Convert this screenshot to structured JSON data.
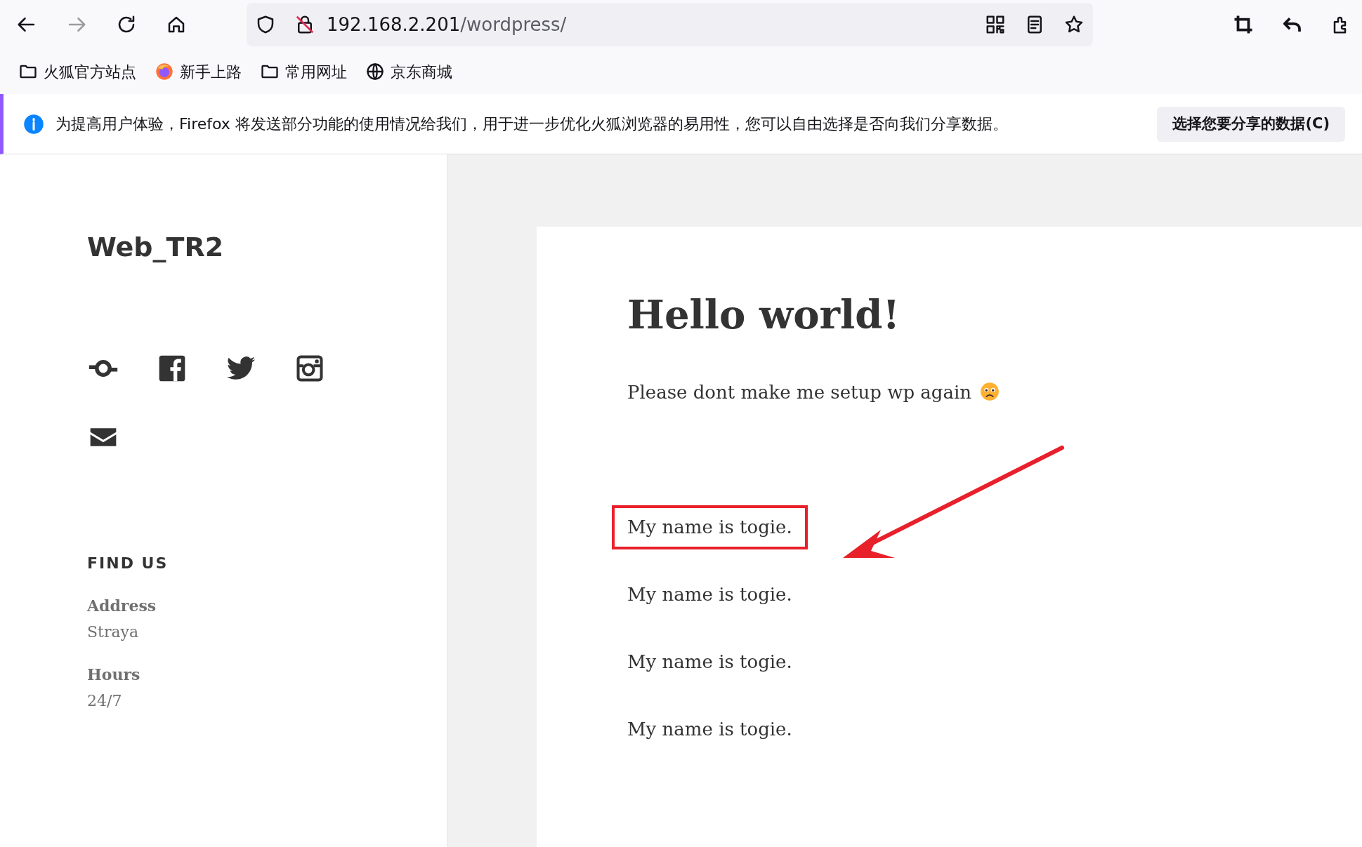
{
  "toolbar": {
    "nav_buttons": [
      {
        "kind": "back",
        "disabled": false
      },
      {
        "kind": "forward",
        "disabled": true
      },
      {
        "kind": "reload",
        "disabled": false
      },
      {
        "kind": "home",
        "disabled": false
      }
    ],
    "url": {
      "host": "192.168.2.201",
      "path": "/wordpress/"
    }
  },
  "bookmarks": [
    {
      "kind": "folder",
      "label": "火狐官方站点"
    },
    {
      "kind": "firefox",
      "label": "新手上路"
    },
    {
      "kind": "folder",
      "label": "常用网址"
    },
    {
      "kind": "globe",
      "label": "京东商城"
    }
  ],
  "notification": {
    "message": "为提高用户体验，Firefox 将发送部分功能的使用情况给我们，用于进一步优化火狐浏览器的易用性，您可以自由选择是否向我们分享数据。",
    "button": "选择您要分享的数据(C)"
  },
  "sidebar": {
    "site_title": "Web_TR2",
    "social": [
      {
        "kind": "link"
      },
      {
        "kind": "facebook"
      },
      {
        "kind": "twitter"
      },
      {
        "kind": "instagram"
      },
      {
        "kind": "email"
      }
    ],
    "widget": {
      "heading": "FIND US",
      "fields": [
        {
          "label": "Address",
          "value": "Straya"
        },
        {
          "label": "Hours",
          "value": "24/7"
        }
      ]
    }
  },
  "post": {
    "title": "Hello world!",
    "annotation_arrow": true,
    "paragraphs": [
      {
        "kind": "emoji",
        "text": "Please dont make me setup wp again",
        "highlighted": false
      },
      {
        "kind": "plain",
        "text": "My name is togie.",
        "highlighted": true
      },
      {
        "kind": "plain",
        "text": "My name is togie.",
        "highlighted": false
      },
      {
        "kind": "plain",
        "text": "My name is togie.",
        "highlighted": false
      },
      {
        "kind": "plain",
        "text": "My name is togie.",
        "highlighted": false
      }
    ]
  }
}
